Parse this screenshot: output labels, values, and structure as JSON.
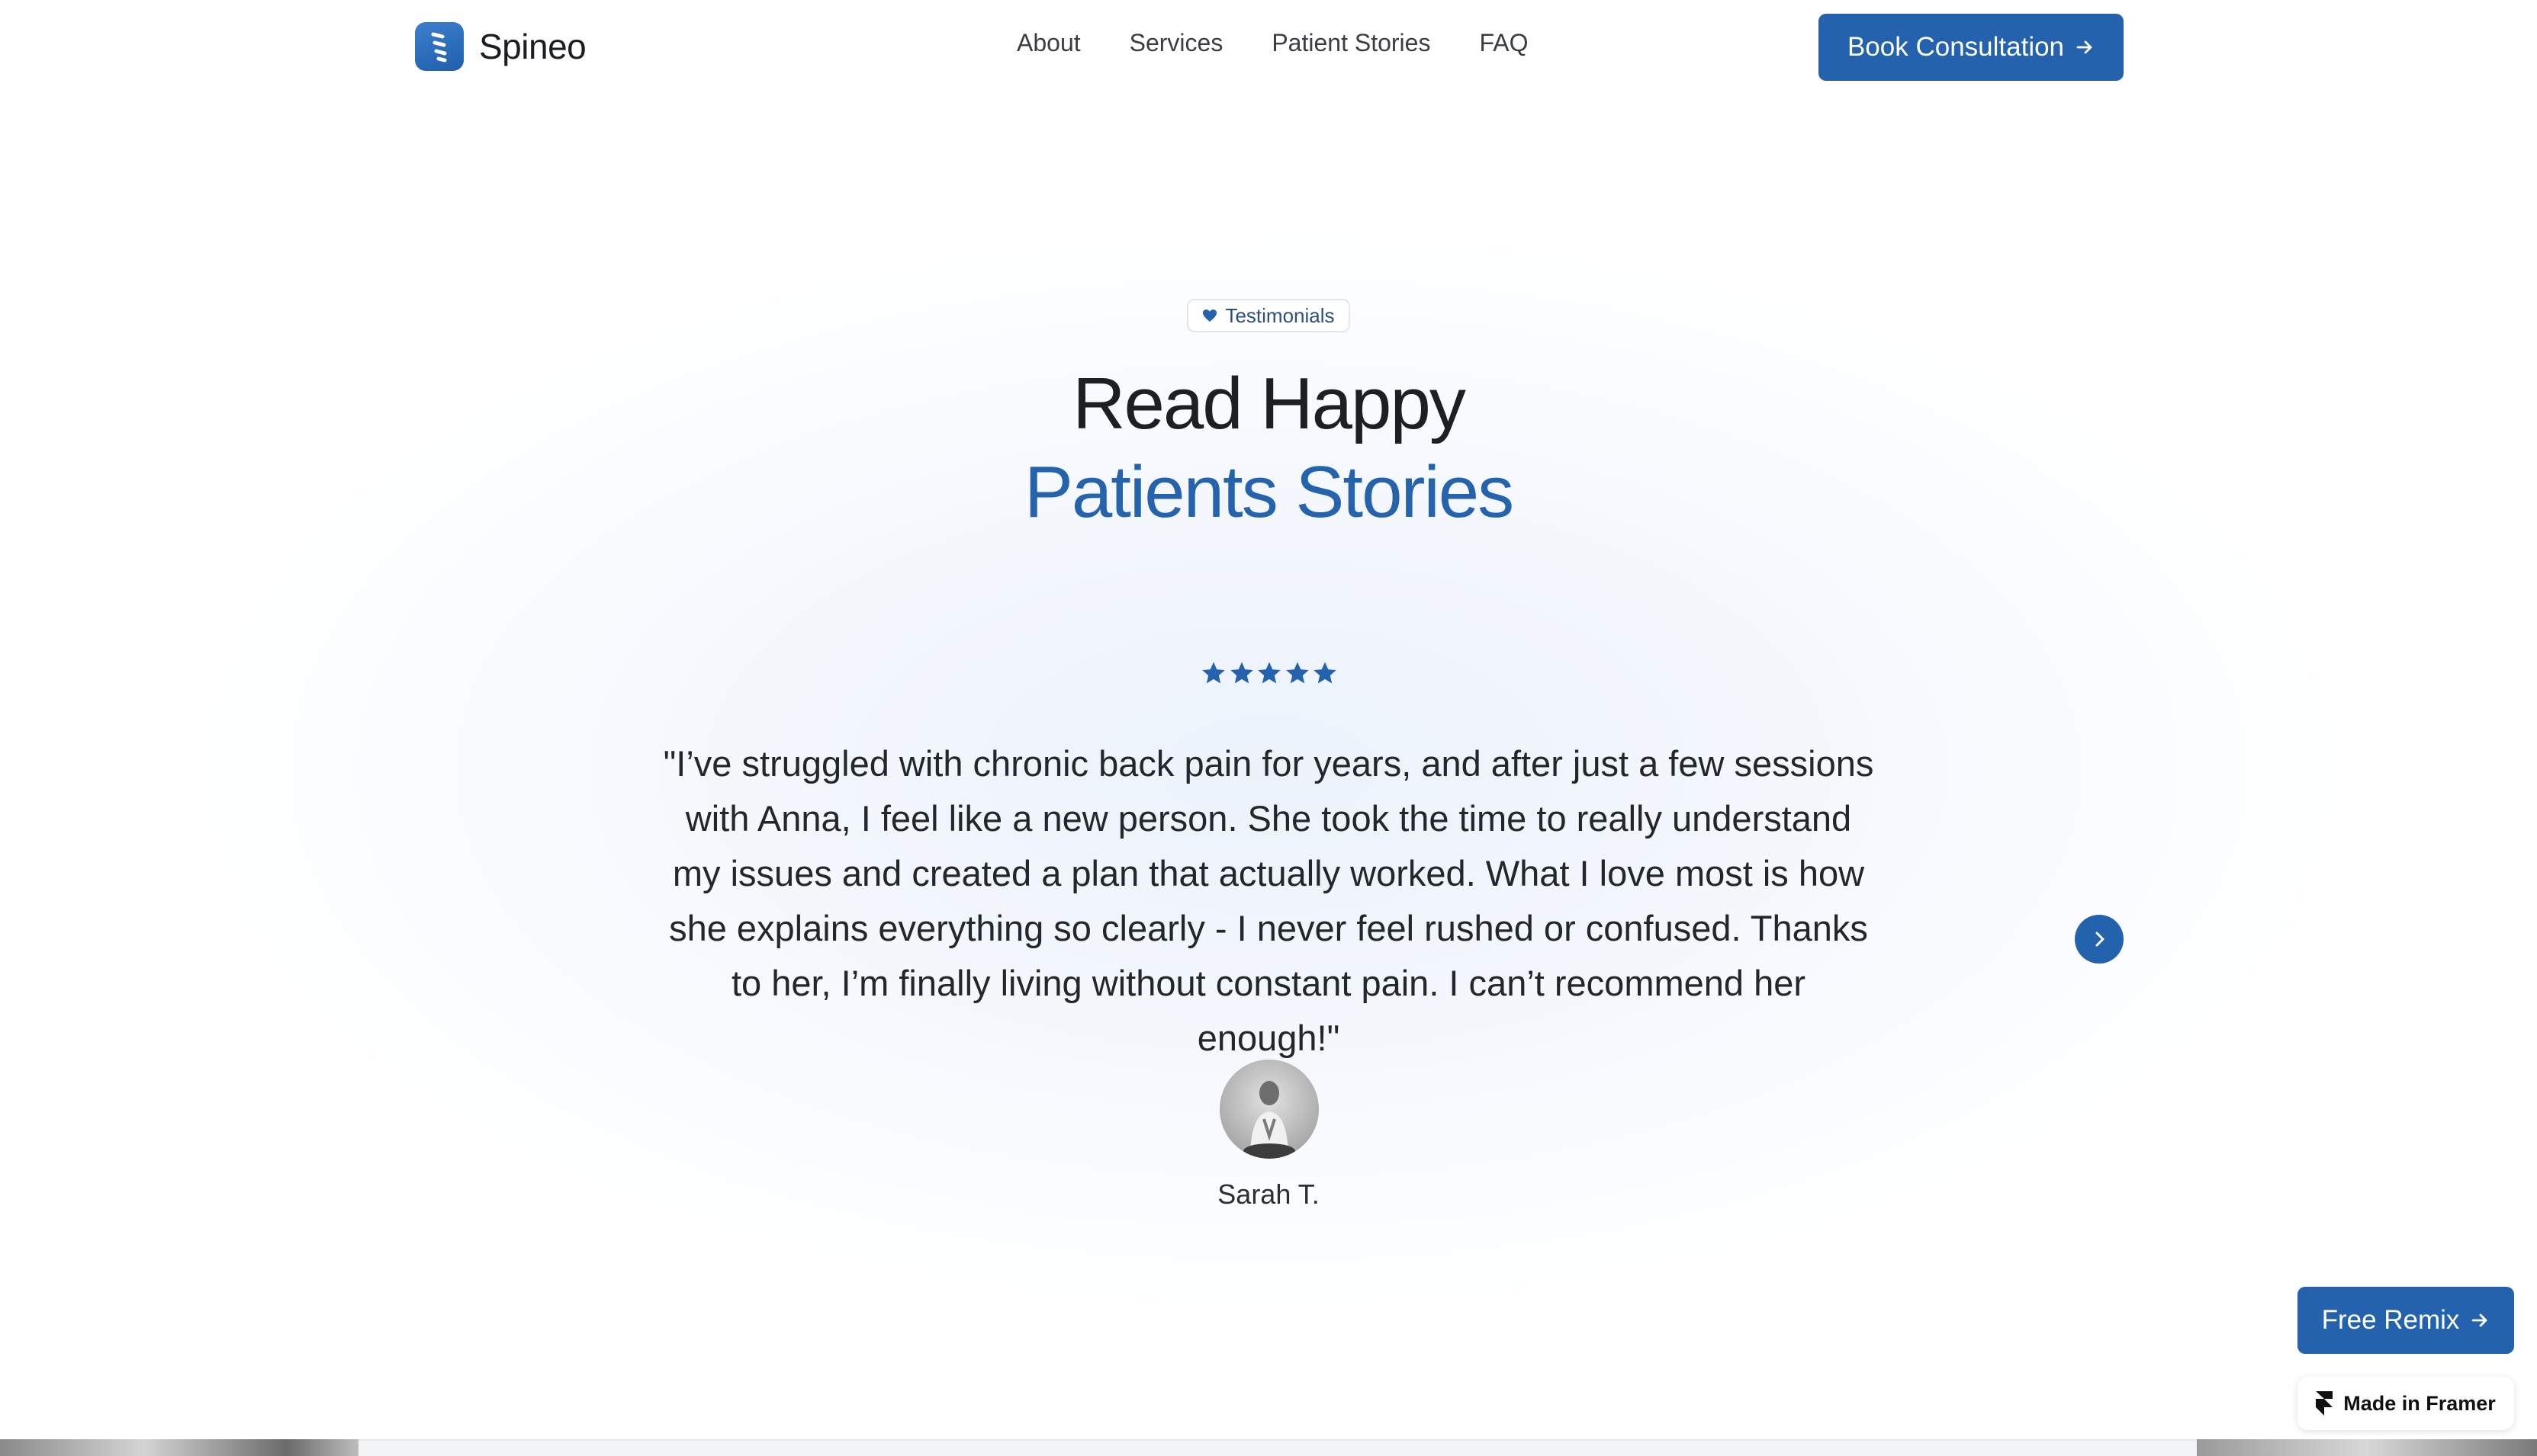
{
  "brand": {
    "name": "Spineo",
    "logo_icon": "spine-logo-icon",
    "accent_color": "#2462ad"
  },
  "nav": {
    "links": [
      "About",
      "Services",
      "Patient Stories",
      "FAQ"
    ],
    "cta_label": "Book Consultation",
    "cta_icon": "arrow-right-icon"
  },
  "hero": {
    "badge_label": "Testimonials",
    "badge_icon": "heart-icon",
    "title_line1": "Read Happy",
    "title_line2": "Patients Stories"
  },
  "testimonial": {
    "rating": 5,
    "rating_max": 5,
    "quote": "\"I’ve struggled with chronic back pain for years, and after just a few sessions with Anna, I feel like a new person. She took the time to really understand my issues and created a plan that actually worked. What I love most is how she explains everything so clearly - I never feel rushed or confused. Thanks to her, I’m finally living without constant pain. I can’t recommend her enough!\"",
    "author": "Sarah T.",
    "next_icon": "chevron-right-icon"
  },
  "floating": {
    "remix_label": "Free Remix",
    "framer_label": "Made in Framer",
    "framer_icon": "framer-logo-icon"
  }
}
